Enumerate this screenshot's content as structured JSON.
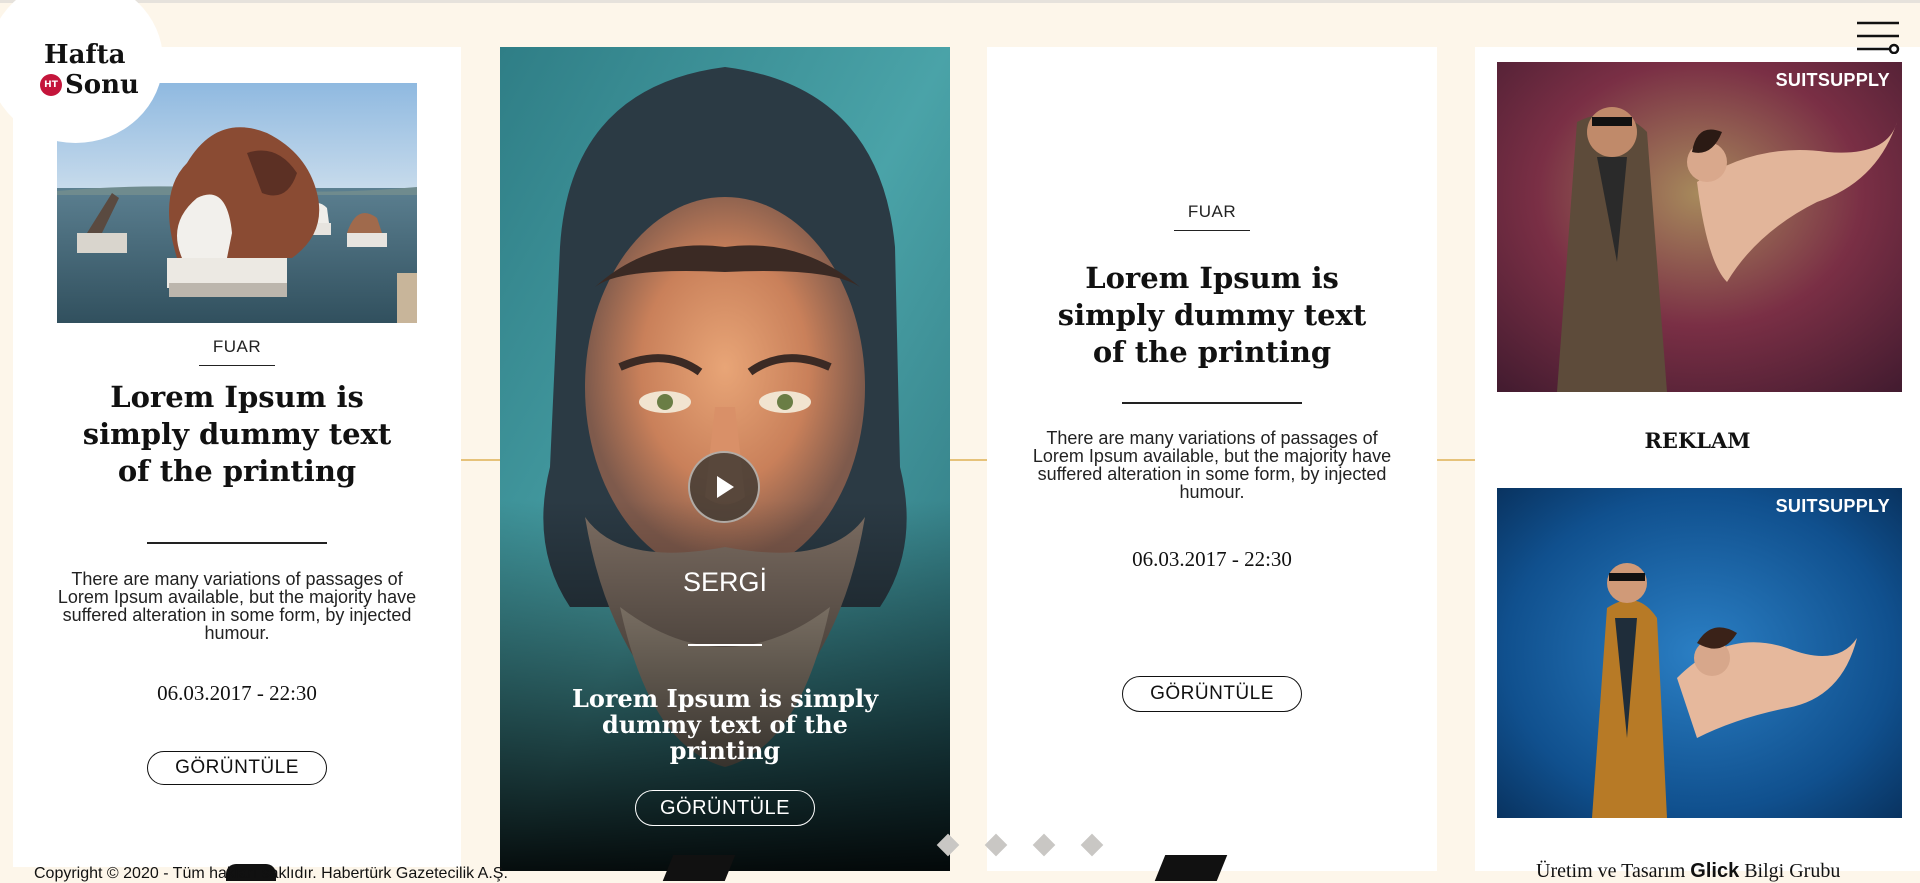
{
  "brand": {
    "line1": "Hafta",
    "line2": "Sonu",
    "badge": "HT"
  },
  "menu": {
    "icon": "menu-slider-icon"
  },
  "cards": [
    {
      "category": "FUAR",
      "title": "Lorem Ipsum is simply dummy text of the printing",
      "description": "There are many variations of passages of Lorem Ipsum available, but the majority have suffered alteration in some form, by injected humour.",
      "date": "06.03.2017 - 22:30",
      "button": "GÖRÜNTÜLE"
    },
    {
      "category": "SERGİ",
      "title": "Lorem Ipsum is simply dummy text of the printing",
      "button": "GÖRÜNTÜLE",
      "play_icon": "play-icon"
    },
    {
      "category": "FUAR",
      "title": "Lorem Ipsum is simply dummy text of the printing",
      "description": "There are many variations of passages of Lorem Ipsum available, but the majority have suffered alteration in some form, by injected humour.",
      "date": "06.03.2017 - 22:30",
      "button": "GÖRÜNTÜLE"
    }
  ],
  "ad": {
    "brand_top": "SUITSUPPLY",
    "label": "REKLAM",
    "brand_bottom": "SUITSUPPLY"
  },
  "pager": {
    "count": 4
  },
  "footer": {
    "copyright": "Copyright © 2020 - Tüm hakları saklıdır. Habertürk Gazetecilik A.Ş.",
    "credit_prefix": "Üretim ve Tasarım",
    "credit_brand": "Glick",
    "credit_suffix": "Bilgi Grubu"
  },
  "colors": {
    "background": "#fdf6ea",
    "connector": "#e6c27a",
    "badge": "#c4153b",
    "pager": "#c9c7c4"
  }
}
